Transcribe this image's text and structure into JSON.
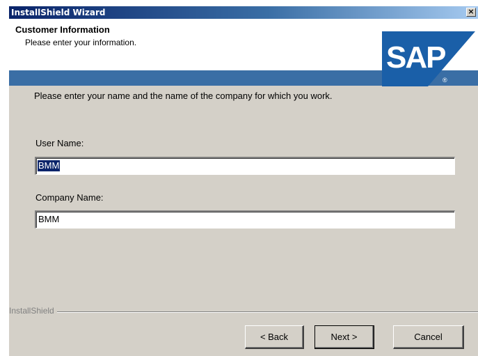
{
  "window": {
    "title": "InstallShield Wizard",
    "close_symbol": "×"
  },
  "header": {
    "heading": "Customer Information",
    "subheading": "Please enter your information.",
    "logo": {
      "name": "SAP",
      "registered": "®",
      "brand_color": "#1a5fa8"
    }
  },
  "main": {
    "instruction": "Please enter your name and the name of the company for which you work.",
    "user_name": {
      "label": "User Name:",
      "value": "BMM"
    },
    "company_name": {
      "label": "Company Name:",
      "value": "BMM"
    }
  },
  "footer": {
    "brand": "InstallShield",
    "back_label": "< Back",
    "next_label": "Next >",
    "cancel_label": "Cancel"
  }
}
